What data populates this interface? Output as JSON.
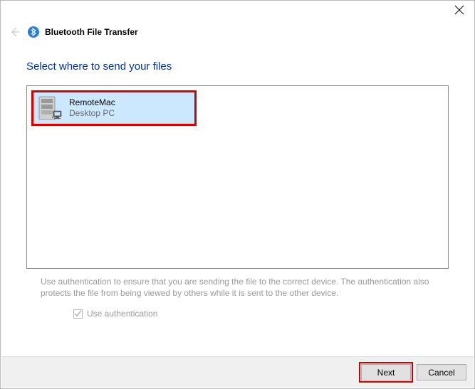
{
  "window": {
    "title": "Bluetooth File Transfer"
  },
  "page": {
    "heading": "Select where to send your files",
    "help_text": "Use authentication to ensure that you are sending the file to the correct device. The authentication also protects the file from being viewed by others while it is sent to the other device.",
    "auth_label": "Use authentication"
  },
  "devices": [
    {
      "name": "RemoteMac",
      "type": "Desktop PC",
      "selected": true
    }
  ],
  "footer": {
    "next_label": "Next",
    "cancel_label": "Cancel"
  }
}
